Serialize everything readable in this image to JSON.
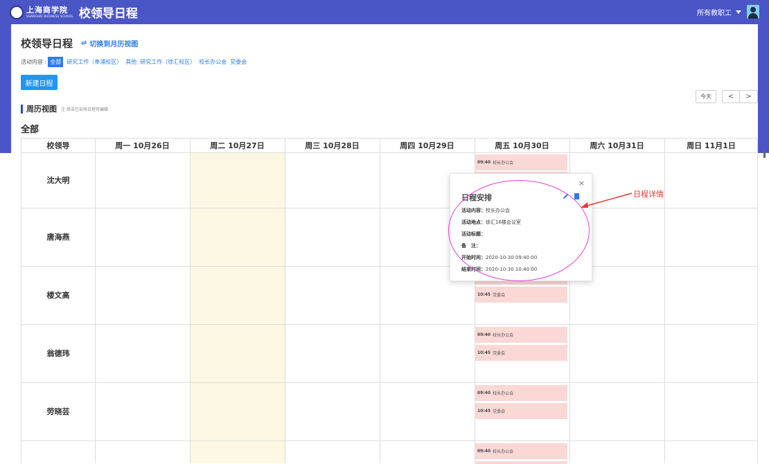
{
  "header": {
    "logo_cn": "上海商学院",
    "logo_en": "SHANGHAI BUSINESS SCHOOL",
    "app_title": "校领导日程",
    "user_dropdown": "所有教职工"
  },
  "page": {
    "title": "校领导日程",
    "switch_view": "切换到月历视图",
    "switch_icon": "list-icon",
    "filter_label": "活动内容 :",
    "filters": [
      "全部",
      "研究工作（奉浦校区）",
      "其他",
      "研究工作（徐汇校区）",
      "校长办公会",
      "党委会"
    ],
    "active_filter": "全部",
    "new_button": "新建日程",
    "section_title": "周历视图",
    "section_note": "注:单击已安排日程可编辑",
    "scope_title": "全部",
    "nav": {
      "today": "今天",
      "prev": "<",
      "next": ">"
    }
  },
  "calendar": {
    "leader_header": "校领导",
    "days": [
      "周一 10月26日",
      "周二 10月27日",
      "周三 10月28日",
      "周四 10月29日",
      "周五 10月30日",
      "周六 10月31日",
      "周日 11月1日"
    ],
    "highlight_day": "周二 10月27日",
    "leaders": [
      "沈大明",
      "唐海燕",
      "楼文高",
      "翁德玮",
      "劳晓芸",
      ""
    ],
    "events": [
      {
        "leader": "沈大明",
        "time": "09:40",
        "title": "校长办公会"
      },
      {
        "leader": "楼文高",
        "time": "10:45",
        "title": "党委会"
      },
      {
        "leader": "翁德玮",
        "time": "09:40",
        "title": "校长办公会"
      },
      {
        "leader": "翁德玮",
        "time": "10:45",
        "title": "党委会"
      },
      {
        "leader": "劳晓芸",
        "time": "09:40",
        "title": "校长办公会"
      },
      {
        "leader": "劳晓芸",
        "time": "10:45",
        "title": "党委会"
      },
      {
        "leader": "",
        "time": "09:40",
        "title": "校长办公会"
      }
    ]
  },
  "popover": {
    "title": "日程安排",
    "close": "×",
    "edit_icon": "pencil-icon",
    "delete_icon": "trash-icon",
    "rows": [
      {
        "k": "活动内容：",
        "v": "校长办公会"
      },
      {
        "k": "活动地点：",
        "v": "徐汇16楼会议室"
      },
      {
        "k": "活动标题：",
        "v": ""
      },
      {
        "k": "备　注：",
        "v": ""
      },
      {
        "k": "开始时间：",
        "v": "2020-10-30 09:40:00"
      },
      {
        "k": "结束时间：",
        "v": "2020-10-30 10:40:00"
      }
    ]
  },
  "annotation": {
    "label": "日程详情",
    "color": "#e53935",
    "ellipse_color": "#e040d8"
  },
  "colors": {
    "brand": "#4a56c6",
    "accent": "#2b7de9",
    "event_bg": "#f9d8d6",
    "today_col": "#fcf8e3"
  }
}
